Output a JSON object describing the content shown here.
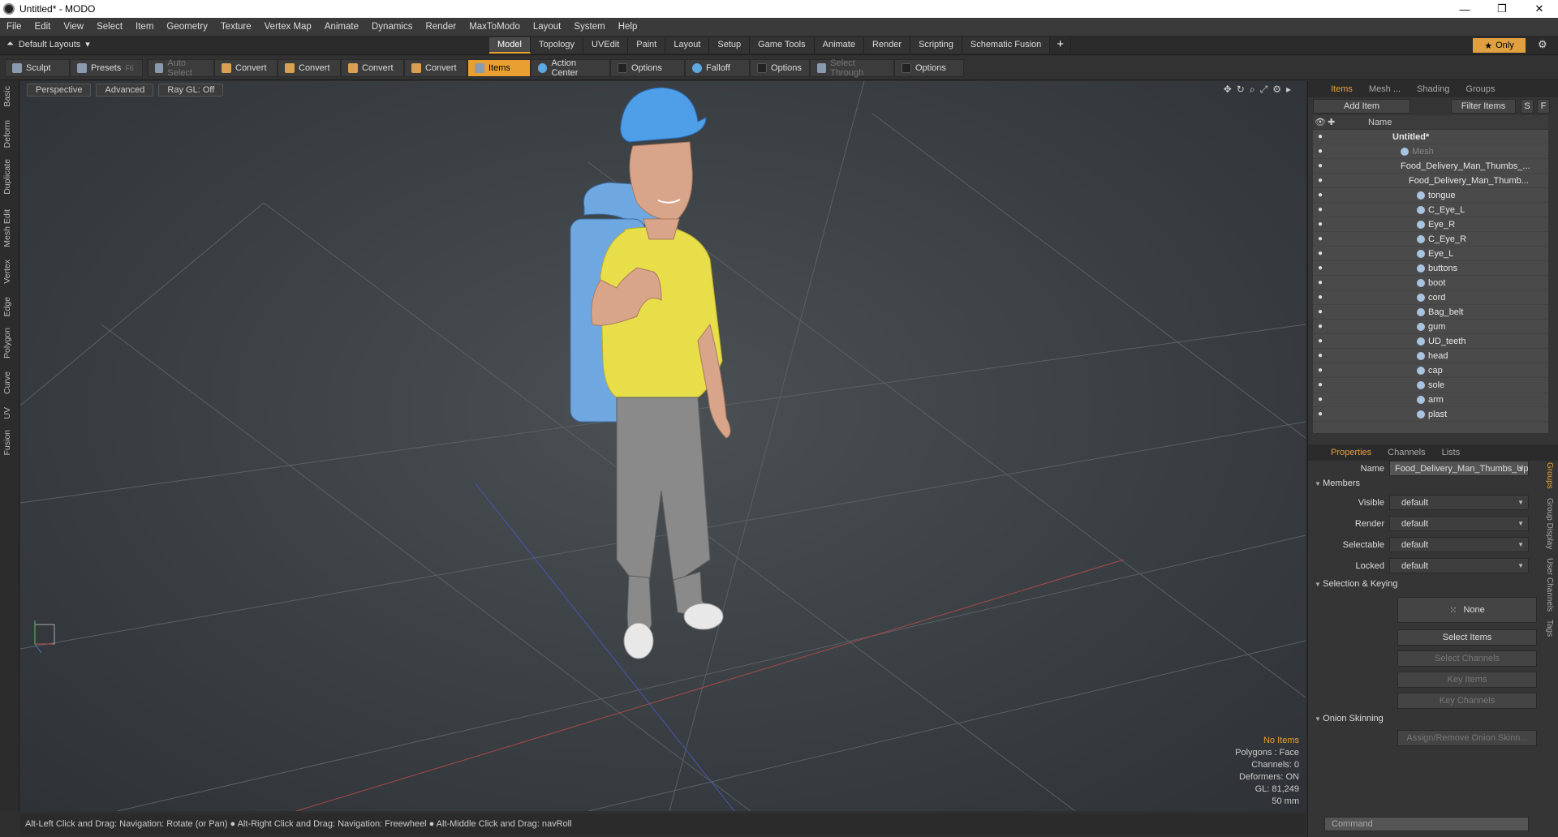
{
  "window": {
    "title": "Untitled* - MODO"
  },
  "menu": [
    "File",
    "Edit",
    "View",
    "Select",
    "Item",
    "Geometry",
    "Texture",
    "Vertex Map",
    "Animate",
    "Dynamics",
    "Render",
    "MaxToModo",
    "Layout",
    "System",
    "Help"
  ],
  "layout": {
    "default_layouts": "Default Layouts",
    "tabs": [
      "Model",
      "Topology",
      "UVEdit",
      "Paint",
      "Layout",
      "Setup",
      "Game Tools",
      "Animate",
      "Render",
      "Scripting",
      "Schematic Fusion"
    ],
    "active_tab": "Model",
    "only_label": "Only"
  },
  "toolbar": {
    "sculpt": "Sculpt",
    "presets": "Presets",
    "presets_key": "F6",
    "auto_select": "Auto Select",
    "convert": "Convert",
    "items": "Items",
    "action_center": "Action Center",
    "options": "Options",
    "falloff": "Falloff",
    "select_through": "Select Through"
  },
  "left_tabs": [
    "Basic",
    "Deform",
    "Duplicate",
    "Mesh Edit",
    "Vertex",
    "Edge",
    "Polygon",
    "Curve",
    "UV",
    "Fusion"
  ],
  "viewport": {
    "view": "Perspective",
    "advanced": "Advanced",
    "raygl": "Ray GL: Off",
    "info": {
      "no_items": "No Items",
      "polygons": "Polygons : Face",
      "channels": "Channels: 0",
      "deformers": "Deformers: ON",
      "gl": "GL: 81,249",
      "scale": "50 mm"
    }
  },
  "status": "Alt-Left Click and Drag: Navigation: Rotate (or Pan) ● Alt-Right Click and Drag: Navigation: Freewheel ● Alt-Middle Click and Drag: navRoll",
  "items_panel": {
    "tabs": [
      "Items",
      "Mesh ...",
      "Shading",
      "Groups"
    ],
    "add_item": "Add Item",
    "filter_items": "Filter Items",
    "s": "S",
    "f": "F",
    "col_name": "Name",
    "rows": [
      {
        "label": "Untitled*",
        "indent": 0
      },
      {
        "label": "Mesh",
        "indent": 1
      },
      {
        "label": "Food_Delivery_Man_Thumbs_...",
        "indent": 1
      },
      {
        "label": "Food_Delivery_Man_Thumb...",
        "indent": 2
      },
      {
        "label": "tongue",
        "indent": 3
      },
      {
        "label": "C_Eye_L",
        "indent": 3
      },
      {
        "label": "Eye_R",
        "indent": 3
      },
      {
        "label": "C_Eye_R",
        "indent": 3
      },
      {
        "label": "Eye_L",
        "indent": 3
      },
      {
        "label": "buttons",
        "indent": 3
      },
      {
        "label": "boot",
        "indent": 3
      },
      {
        "label": "cord",
        "indent": 3
      },
      {
        "label": "Bag_belt",
        "indent": 3
      },
      {
        "label": "gum",
        "indent": 3
      },
      {
        "label": "UD_teeth",
        "indent": 3
      },
      {
        "label": "head",
        "indent": 3
      },
      {
        "label": "cap",
        "indent": 3
      },
      {
        "label": "sole",
        "indent": 3
      },
      {
        "label": "arm",
        "indent": 3
      },
      {
        "label": "plast",
        "indent": 3
      }
    ]
  },
  "properties": {
    "tabs": [
      "Properties",
      "Channels",
      "Lists"
    ],
    "name_label": "Name",
    "name_value": "Food_Delivery_Man_Thumbs_Up",
    "members": "Members",
    "fields": [
      {
        "label": "Visible",
        "value": "default"
      },
      {
        "label": "Render",
        "value": "default"
      },
      {
        "label": "Selectable",
        "value": "default"
      },
      {
        "label": "Locked",
        "value": "default"
      }
    ],
    "selection_keying": "Selection & Keying",
    "none": "None",
    "select_items": "Select Items",
    "select_channels": "Select Channels",
    "key_items": "Key Items",
    "key_channels": "Key Channels",
    "onion": "Onion Skinning",
    "assign_onion": "Assign/Remove Onion Skinn...",
    "side_tabs": [
      "Groups",
      "Group Display",
      "User Channels",
      "Tags"
    ],
    "command_placeholder": "Command"
  },
  "colors": {
    "accent": "#e9a030",
    "shirt": "#e8de4a",
    "cap": "#4f9ee8",
    "bag": "#6fa8e0",
    "pants": "#8a8a8a"
  }
}
